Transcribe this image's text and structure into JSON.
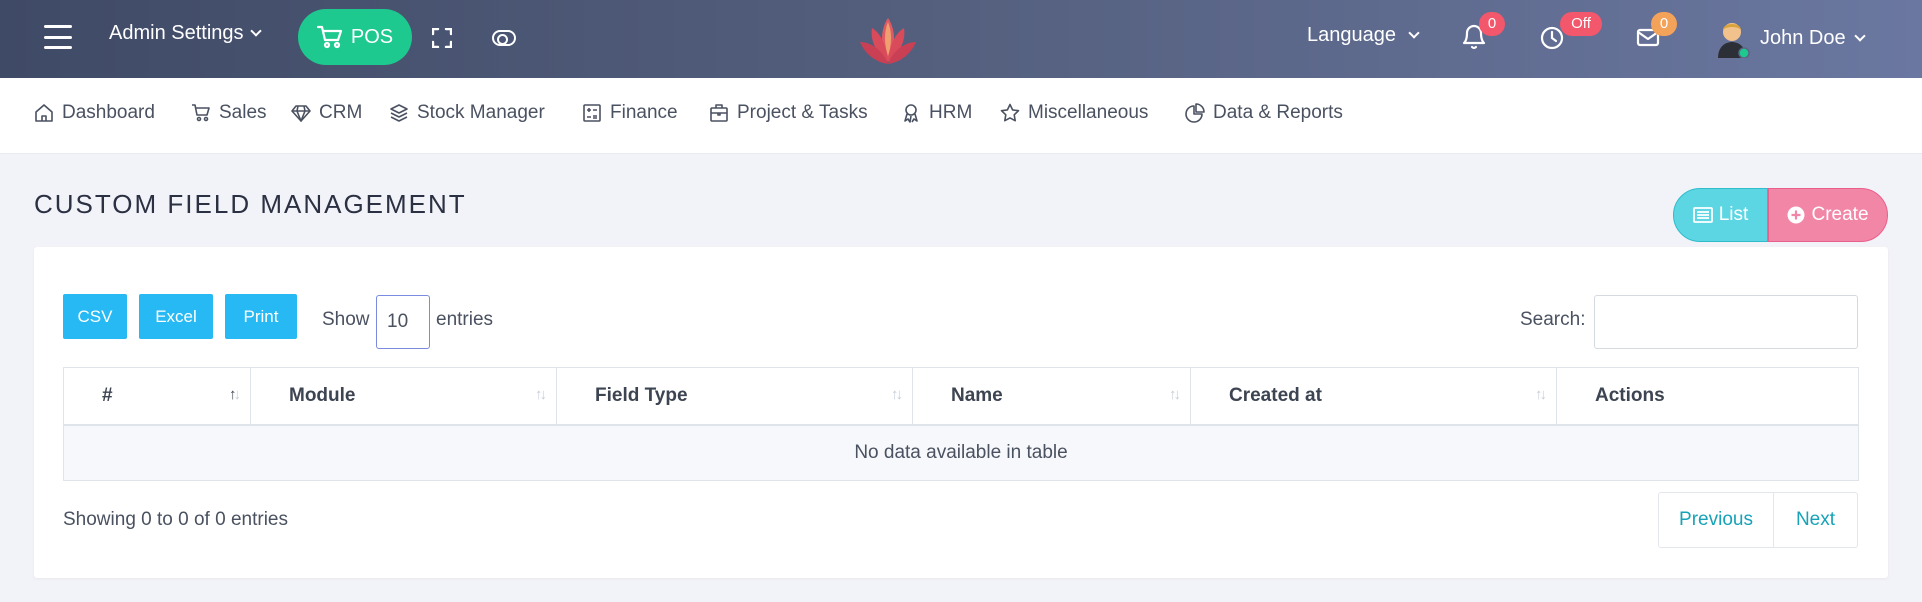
{
  "header": {
    "admin_settings_label": "Admin Settings",
    "pos_label": "POS",
    "language_label": "Language",
    "notifications_count": "0",
    "clock_status": "Off",
    "messages_count": "0",
    "user_name": "John Doe",
    "colors": {
      "pos_green": "#1ec98f",
      "badge_red": "#f3576b",
      "badge_orange": "#f3a25a"
    }
  },
  "nav": {
    "items": [
      {
        "label": "Dashboard",
        "icon": "home-icon"
      },
      {
        "label": "Sales",
        "icon": "cart-icon"
      },
      {
        "label": "CRM",
        "icon": "diamond-icon"
      },
      {
        "label": "Stock Manager",
        "icon": "layers-icon"
      },
      {
        "label": "Finance",
        "icon": "calculator-icon"
      },
      {
        "label": "Project & Tasks",
        "icon": "briefcase-icon"
      },
      {
        "label": "HRM",
        "icon": "award-icon"
      },
      {
        "label": "Miscellaneous",
        "icon": "star-icon"
      },
      {
        "label": "Data & Reports",
        "icon": "pie-chart-icon"
      }
    ]
  },
  "page": {
    "title": "CUSTOM FIELD MANAGEMENT",
    "list_label": "List",
    "create_label": "Create"
  },
  "table_controls": {
    "csv_label": "CSV",
    "excel_label": "Excel",
    "print_label": "Print",
    "show_label": "Show",
    "entries_value": "10",
    "entries_label": "entries",
    "search_label": "Search:",
    "search_value": ""
  },
  "table": {
    "columns": [
      "#",
      "Module",
      "Field Type",
      "Name",
      "Created at",
      "Actions"
    ],
    "empty_message": "No data available in table"
  },
  "footer": {
    "showing_text": "Showing 0 to 0 of 0 entries",
    "previous_label": "Previous",
    "next_label": "Next"
  }
}
